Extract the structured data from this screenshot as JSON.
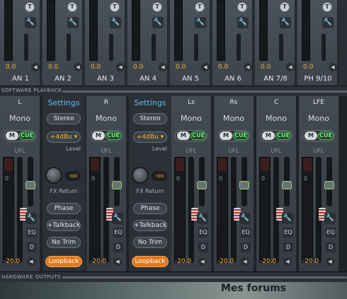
{
  "inputs": [
    {
      "name": "AN 1",
      "value": "0.0"
    },
    {
      "name": "AN 2",
      "value": "0.0"
    },
    {
      "name": "AN 3",
      "value": "0.0"
    },
    {
      "name": "AN 4",
      "value": "0.0"
    },
    {
      "name": "AN 5",
      "value": "0.0"
    },
    {
      "name": "AN 6",
      "value": "0.0"
    },
    {
      "name": "AN 7/8",
      "value": "0.0"
    },
    {
      "name": "PH 9/10",
      "value": "0.0"
    }
  ],
  "input_buttons": {
    "t_label": "T"
  },
  "software_playback_label": "SOFTWARE PLAYBACK",
  "hardware_outputs_label": "HARDWARE OUTPUTS",
  "channels": [
    {
      "name": "L",
      "mode": "Mono",
      "mute": "M",
      "cue": "CUE",
      "ufl": "UFL",
      "zero": "0",
      "eq": "EQ",
      "d": "D",
      "value": "-20.0"
    },
    {
      "name": "R",
      "mode": "Mono",
      "mute": "M",
      "cue": "CUE",
      "ufl": "UFL",
      "zero": "0",
      "eq": "EQ",
      "d": "D",
      "value": "-20.0"
    },
    {
      "name": "Ls",
      "mode": "Mono",
      "mute": "M",
      "cue": "CUE",
      "ufl": "UFL",
      "zero": "0",
      "eq": "EQ",
      "d": "D",
      "value": "-20.0"
    },
    {
      "name": "Rs",
      "mode": "Mono",
      "mute": "M",
      "cue": "CUE",
      "ufl": "UFL",
      "zero": "0",
      "eq": "EQ",
      "d": "D",
      "value": "-20.0"
    },
    {
      "name": "C",
      "mode": "Mono",
      "mute": "M",
      "cue": "CUE",
      "ufl": "UFL",
      "zero": "0",
      "eq": "EQ",
      "d": "D",
      "value": "-20.0"
    },
    {
      "name": "LFE",
      "mode": "Mono",
      "mute": "M",
      "cue": "CUE",
      "ufl": "UFL",
      "zero": "0",
      "eq": "EQ",
      "d": "D",
      "value": "-20.0"
    }
  ],
  "settings": [
    {
      "title": "Settings",
      "stereo": "Stereo",
      "level": "+4dBu",
      "level_label": "Level",
      "knob_value": "-oo",
      "fx_return": "FX Return",
      "phase": "Phase",
      "talkback": "+Talkback",
      "no_trim": "No Trim",
      "loopback": "Loopback"
    },
    {
      "title": "Settings",
      "stereo": "Stereo",
      "level": "+4dBu",
      "level_label": "Level",
      "knob_value": "-oo",
      "fx_return": "FX Return",
      "phase": "Phase",
      "talkback": "+Talkback",
      "no_trim": "No Trim",
      "loopback": "Loopback"
    }
  ],
  "background_text": "Mes forums",
  "colors": {
    "accent_orange": "#e07a1f",
    "cue_green": "#43d05a",
    "value_amber": "#f0b43c",
    "settings_blue": "#5fbdf0"
  }
}
